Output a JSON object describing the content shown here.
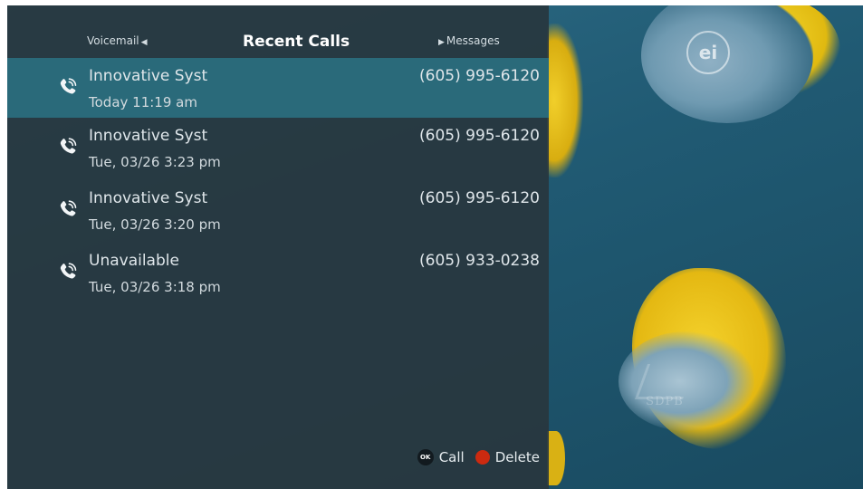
{
  "header": {
    "left_tab": "Voicemail",
    "title": "Recent Calls",
    "right_tab": "Messages"
  },
  "calls": [
    {
      "name": "Innovative Syst",
      "time": "Today 11:19 am",
      "number": "(605) 995-6120",
      "selected": true
    },
    {
      "name": "Innovative Syst",
      "time": "Tue, 03/26 3:23 pm",
      "number": "(605) 995-6120",
      "selected": false
    },
    {
      "name": "Innovative Syst",
      "time": "Tue, 03/26 3:20 pm",
      "number": "(605) 995-6120",
      "selected": false
    },
    {
      "name": "Unavailable",
      "time": "Tue, 03/26 3:18 pm",
      "number": "(605) 933-0238",
      "selected": false
    }
  ],
  "footer": {
    "ok_glyph": "OK",
    "call_label": "Call",
    "delete_label": "Delete"
  },
  "overlay": {
    "logo_text": "ei",
    "watermark_text": "SDPB"
  },
  "colors": {
    "selected_row": "#2a6a7a",
    "delete_button": "#cc2a10",
    "panel_bg": "#28373e"
  },
  "icons": {
    "call_row_icon": "phone-incoming-icon"
  }
}
